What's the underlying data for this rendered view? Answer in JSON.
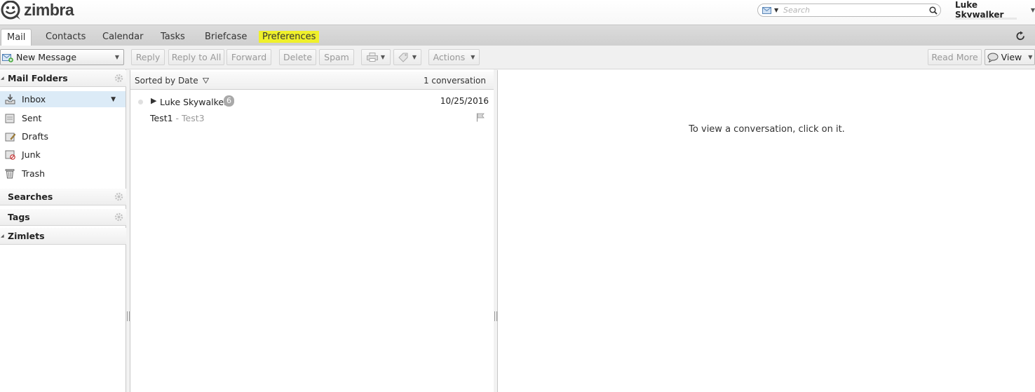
{
  "brand": {
    "name": "zimbra"
  },
  "search": {
    "placeholder": "Search",
    "scope_icon": "mail-icon"
  },
  "user": {
    "name": "Luke Skywalker"
  },
  "app_tabs": [
    {
      "label": "Mail",
      "active": true
    },
    {
      "label": "Contacts"
    },
    {
      "label": "Calendar"
    },
    {
      "label": "Tasks"
    },
    {
      "label": "Briefcase"
    },
    {
      "label": "Preferences",
      "highlighted": true,
      "highlight_color": "#eff02a"
    }
  ],
  "toolbar": {
    "new_message": "New Message",
    "reply": "Reply",
    "reply_all": "Reply to All",
    "forward": "Forward",
    "delete": "Delete",
    "spam": "Spam",
    "actions": "Actions",
    "read_more": "Read More",
    "view": "View"
  },
  "sidebar": {
    "mail_folders": "Mail Folders",
    "folders": [
      {
        "label": "Inbox",
        "icon": "inbox-icon",
        "selected": true
      },
      {
        "label": "Sent",
        "icon": "sent-icon"
      },
      {
        "label": "Drafts",
        "icon": "drafts-icon"
      },
      {
        "label": "Junk",
        "icon": "junk-icon"
      },
      {
        "label": "Trash",
        "icon": "trash-icon"
      }
    ],
    "searches": "Searches",
    "tags": "Tags",
    "zimlets": "Zimlets"
  },
  "list": {
    "sort_label": "Sorted by Date",
    "count": "1 conversation",
    "conversations": [
      {
        "sender": "Luke Skywalker -",
        "message_count": "6",
        "date": "10/25/2016",
        "subject": "Test1",
        "fragment": " - Test3"
      }
    ]
  },
  "reading_pane": {
    "empty_message": "To view a conversation, click on it."
  },
  "colors": {
    "selected_row": "#dcebf7",
    "tab_highlight": "#eff02a"
  }
}
